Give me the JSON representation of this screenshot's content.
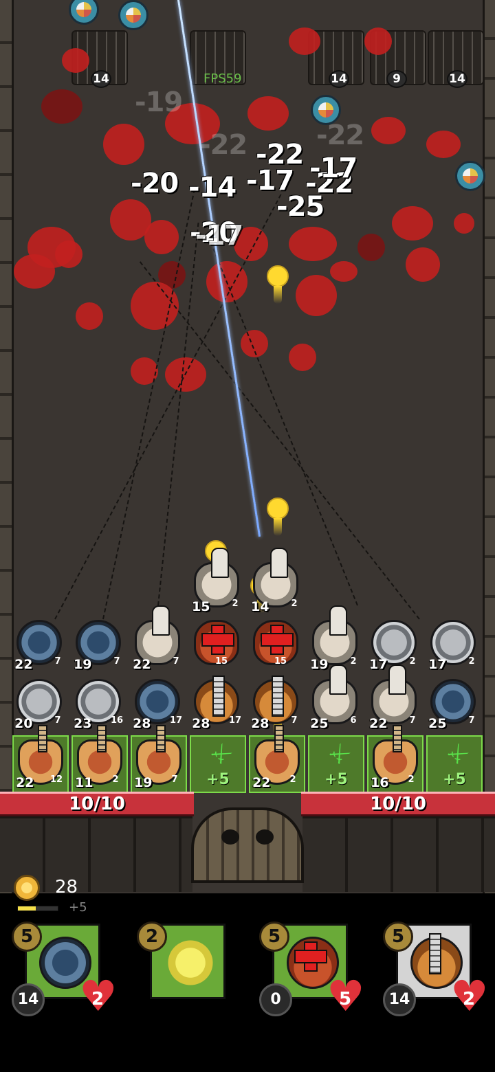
{
  "hud": {
    "fps": "FPS59",
    "coins": "28",
    "xp_gain": "+5",
    "xp_fraction": 0.45
  },
  "spawners": [
    {
      "count": "14"
    },
    {
      "count": "14"
    },
    {
      "count": "9"
    },
    {
      "count": "14"
    }
  ],
  "damage_numbers": [
    "-20",
    "-14",
    "-17",
    "-22",
    "-22",
    "-17",
    "-25",
    "-20",
    "-17",
    "-19",
    "-22",
    "-22"
  ],
  "board": {
    "row1": [
      {
        "level": "15",
        "hp": "2",
        "type": "cannon"
      },
      {
        "level": "14",
        "hp": "2",
        "type": "cannon"
      }
    ],
    "row2": [
      {
        "level": "22",
        "hp": "7",
        "type": "blue"
      },
      {
        "level": "19",
        "hp": "7",
        "type": "blue"
      },
      {
        "level": "22",
        "hp": "7",
        "type": "cannon"
      },
      {
        "level": "",
        "hp": "15",
        "type": "heal"
      },
      {
        "level": "",
        "hp": "15",
        "type": "heal"
      },
      {
        "level": "19",
        "hp": "2",
        "type": "cannon"
      },
      {
        "level": "17",
        "hp": "2",
        "type": "gray"
      },
      {
        "level": "17",
        "hp": "2",
        "type": "gray"
      }
    ],
    "row3": [
      {
        "level": "20",
        "hp": "7",
        "type": "gray"
      },
      {
        "level": "23",
        "hp": "16",
        "type": "gray"
      },
      {
        "level": "28",
        "hp": "17",
        "type": "blue"
      },
      {
        "level": "28",
        "hp": "17",
        "type": "gun"
      },
      {
        "level": "28",
        "hp": "7",
        "type": "gun"
      },
      {
        "level": "25",
        "hp": "6",
        "type": "cannon"
      },
      {
        "level": "22",
        "hp": "7",
        "type": "cannon"
      },
      {
        "level": "25",
        "hp": "7",
        "type": "blue"
      }
    ],
    "row4": [
      {
        "level": "22",
        "hp": "12",
        "type": "guitar"
      },
      {
        "level": "11",
        "hp": "2",
        "type": "guitar"
      },
      {
        "level": "19",
        "hp": "7",
        "type": "guitar"
      },
      {
        "boost": "+5"
      },
      {
        "level": "22",
        "hp": "2",
        "type": "guitar"
      },
      {
        "boost": "+5"
      },
      {
        "level": "16",
        "hp": "2",
        "type": "guitar"
      },
      {
        "boost": "+5"
      }
    ]
  },
  "walls": {
    "left_hp": "10/10",
    "right_hp": "10/10"
  },
  "cards": [
    {
      "cost": "5",
      "level": "14",
      "hp": "2",
      "type": "blue",
      "bg": "green"
    },
    {
      "cost": "2",
      "type": "spike",
      "bg": "green"
    },
    {
      "cost": "5",
      "level": "0",
      "hp": "5",
      "type": "heal",
      "bg": "green"
    },
    {
      "cost": "5",
      "level": "14",
      "hp": "2",
      "type": "gun",
      "bg": "gray"
    }
  ],
  "colors": {
    "wall_hp": "#c8323b",
    "boost": "#59e24a",
    "blood": "#c2201f",
    "projectile": "#ffd92f"
  }
}
